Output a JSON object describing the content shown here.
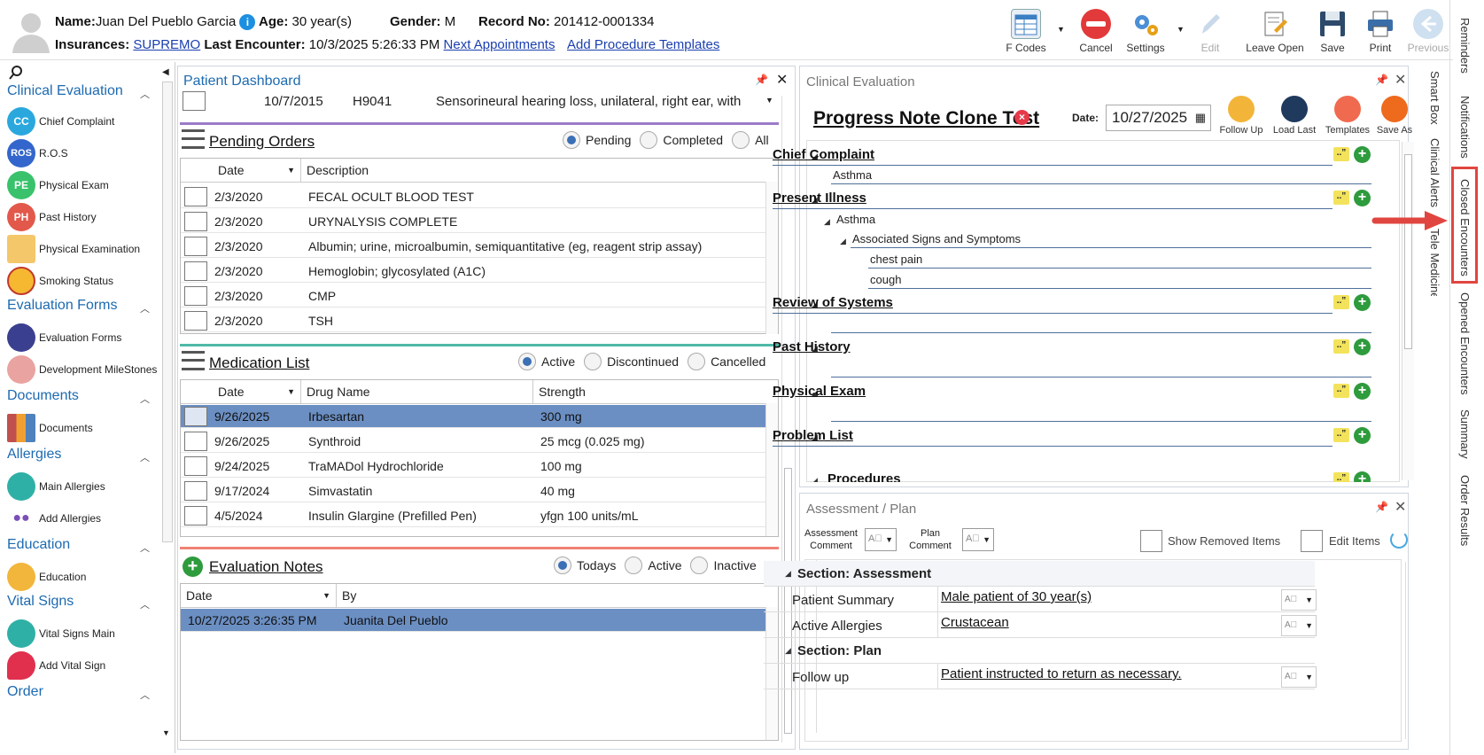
{
  "patient": {
    "name_label": "Name:",
    "name": "Juan Del Pueblo Garcia",
    "age_label": "Age:",
    "age": "30 year(s)",
    "gender_label": "Gender:",
    "gender": "M",
    "record_label": "Record No:",
    "record": "201412-0001334",
    "insurances_label": "Insurances:",
    "insurance": "SUPREMO",
    "last_encounter_label": "Last Encounter:",
    "last_encounter": "10/3/2025 5:26:33 PM",
    "next_appointments": "Next Appointments",
    "add_procedure_templates": "Add Procedure Templates"
  },
  "toolbar": {
    "fcodes": "F Codes",
    "cancel": "Cancel",
    "settings": "Settings",
    "edit": "Edit",
    "leave_open": "Leave Open",
    "save": "Save",
    "print": "Print",
    "previous": "Previous"
  },
  "sidebar": {
    "sections": [
      {
        "title": "Clinical Evaluation",
        "items": [
          {
            "label": "Chief Complaint",
            "icon": "CC"
          },
          {
            "label": "R.O.S",
            "icon": "ROS"
          },
          {
            "label": "Physical Exam",
            "icon": "PE"
          },
          {
            "label": "Past History",
            "icon": "PH"
          },
          {
            "label": "Physical Examination",
            "icon": "clipboard-icon"
          },
          {
            "label": "Smoking Status",
            "icon": "no-smoking-icon"
          }
        ]
      },
      {
        "title": "Evaluation Forms",
        "items": [
          {
            "label": "Evaluation Forms",
            "icon": "form-icon"
          },
          {
            "label": "Development MileStones",
            "icon": "milestones-icon"
          }
        ]
      },
      {
        "title": "Documents",
        "items": [
          {
            "label": "Documents",
            "icon": "binders-icon"
          }
        ]
      },
      {
        "title": "Allergies",
        "items": [
          {
            "label": "Main Allergies",
            "icon": "allergy-icon"
          },
          {
            "label": "Add Allergies",
            "icon": "pills-icon"
          }
        ]
      },
      {
        "title": "Education",
        "items": [
          {
            "label": "Education",
            "icon": "reader-icon"
          }
        ]
      },
      {
        "title": "Vital Signs",
        "items": [
          {
            "label": "Vital Signs Main",
            "icon": "heartbeat-icon"
          },
          {
            "label": "Add Vital Sign",
            "icon": "heart-plus-icon"
          }
        ]
      },
      {
        "title": "Order",
        "items": []
      }
    ]
  },
  "dashboard": {
    "title": "Patient Dashboard",
    "top_row": {
      "date": "10/7/2015",
      "code": "H9041",
      "desc": "Sensorineural hearing loss, unilateral, right ear, with"
    },
    "pending_orders": {
      "title": "Pending Orders",
      "filters": [
        "Pending",
        "Completed",
        "All"
      ],
      "columns": [
        "Date",
        "Description"
      ],
      "rows": [
        {
          "date": "2/3/2020",
          "desc": "FECAL OCULT BLOOD TEST"
        },
        {
          "date": "2/3/2020",
          "desc": "URYNALYSIS COMPLETE"
        },
        {
          "date": "2/3/2020",
          "desc": "Albumin; urine, microalbumin, semiquantitative (eg, reagent strip assay)"
        },
        {
          "date": "2/3/2020",
          "desc": "Hemoglobin; glycosylated (A1C)"
        },
        {
          "date": "2/3/2020",
          "desc": "CMP"
        },
        {
          "date": "2/3/2020",
          "desc": "TSH"
        }
      ]
    },
    "medication_list": {
      "title": "Medication List",
      "filters": [
        "Active",
        "Discontinued",
        "Cancelled"
      ],
      "columns": [
        "Date",
        "Drug Name",
        "Strength"
      ],
      "rows": [
        {
          "date": "9/26/2025",
          "drug": "Irbesartan",
          "strength": "300 mg"
        },
        {
          "date": "9/26/2025",
          "drug": "Synthroid",
          "strength": "25 mcg (0.025 mg)"
        },
        {
          "date": "9/24/2025",
          "drug": "TraMADol Hydrochloride",
          "strength": "100 mg"
        },
        {
          "date": "9/17/2024",
          "drug": "Simvastatin",
          "strength": "40 mg"
        },
        {
          "date": "4/5/2024",
          "drug": "Insulin Glargine (Prefilled Pen)",
          "strength": "yfgn 100 units/mL"
        }
      ]
    },
    "evaluation_notes": {
      "title": "Evaluation Notes",
      "filters": [
        "Todays",
        "Active",
        "Inactive"
      ],
      "columns": [
        "Date",
        "By"
      ],
      "rows": [
        {
          "date": "10/27/2025 3:26:35 PM",
          "by": "Juanita Del Pueblo"
        }
      ]
    }
  },
  "clinical": {
    "title": "Clinical Evaluation",
    "note_title": "Progress Note Clone Test",
    "date_label": "Date:",
    "date": "10/27/2025",
    "actions": [
      "Follow Up",
      "Load Last",
      "Templates",
      "Save As"
    ],
    "sections": {
      "chief": "Chief Complaint",
      "chief_item": "Asthma",
      "present": "Present Illness",
      "present_item": "Asthma",
      "assoc": "Associated Signs and Symptoms",
      "symptom1": "chest pain",
      "symptom2": "cough",
      "ros": "Review of Systems",
      "past": "Past History",
      "pe": "Physical Exam",
      "problem": "Problem List",
      "proc": "Procedures"
    }
  },
  "assessment": {
    "title": "Assessment / Plan",
    "assessment_comment": "Assessment Comment",
    "plan_comment": "Plan Comment",
    "show_removed": "Show Removed Items",
    "edit_items": "Edit Items",
    "section_assessment": "Section: Assessment",
    "patient_summary_label": "Patient Summary",
    "patient_summary": "Male patient of 30 year(s)",
    "allergies_label": "Active Allergies",
    "allergies": "Crustacean",
    "section_plan": "Section: Plan",
    "followup_label": "Follow up",
    "followup": "Patient instructed to return as necessary."
  },
  "right_tabs": [
    "Reminders",
    "Notifications",
    "Closed Encounters",
    "Opened Encounters",
    "Summary",
    "Order Results"
  ],
  "inner_tabs": [
    "Smart Box",
    "Clinical Alerts",
    "Tele Medicine"
  ],
  "colors": {
    "accent": "#1d6ab0",
    "selected": "#6b8fc3",
    "highlight": "#e0463f"
  }
}
